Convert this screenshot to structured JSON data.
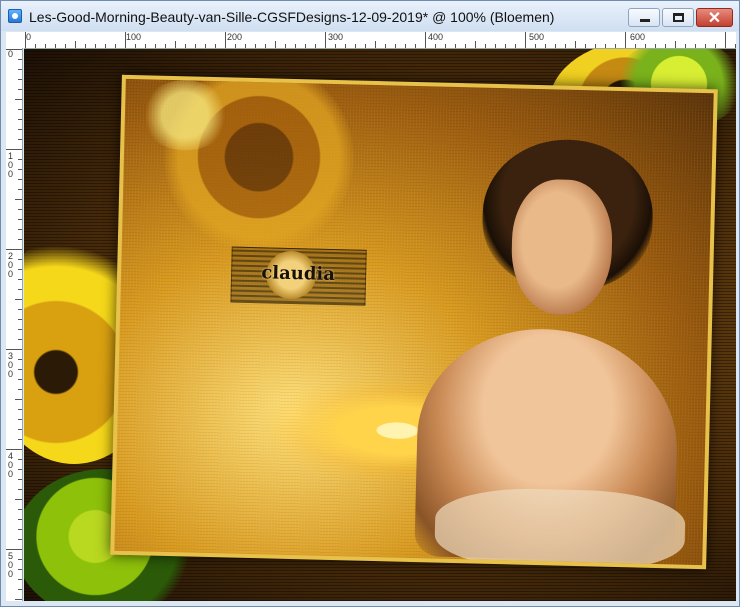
{
  "window": {
    "title": "Les-Good-Morning-Beauty-van-Sille-CGSFDesigns-12-09-2019* @ 100% (Bloemen)",
    "close_glyph": "✕",
    "buttons": [
      "minimize-button",
      "maximize-button",
      "close-button"
    ]
  },
  "ruler": {
    "horizontal_labels": [
      "0",
      "100",
      "200",
      "300",
      "400",
      "500",
      "600"
    ],
    "vertical_labels": [
      "0",
      "100",
      "200",
      "300",
      "400",
      "500"
    ]
  },
  "canvas": {
    "signature_text": "claudia"
  },
  "colors": {
    "titlebar": "#dce7f4",
    "close_button": "#c2412f",
    "frame_gold": "#e8c14a"
  }
}
